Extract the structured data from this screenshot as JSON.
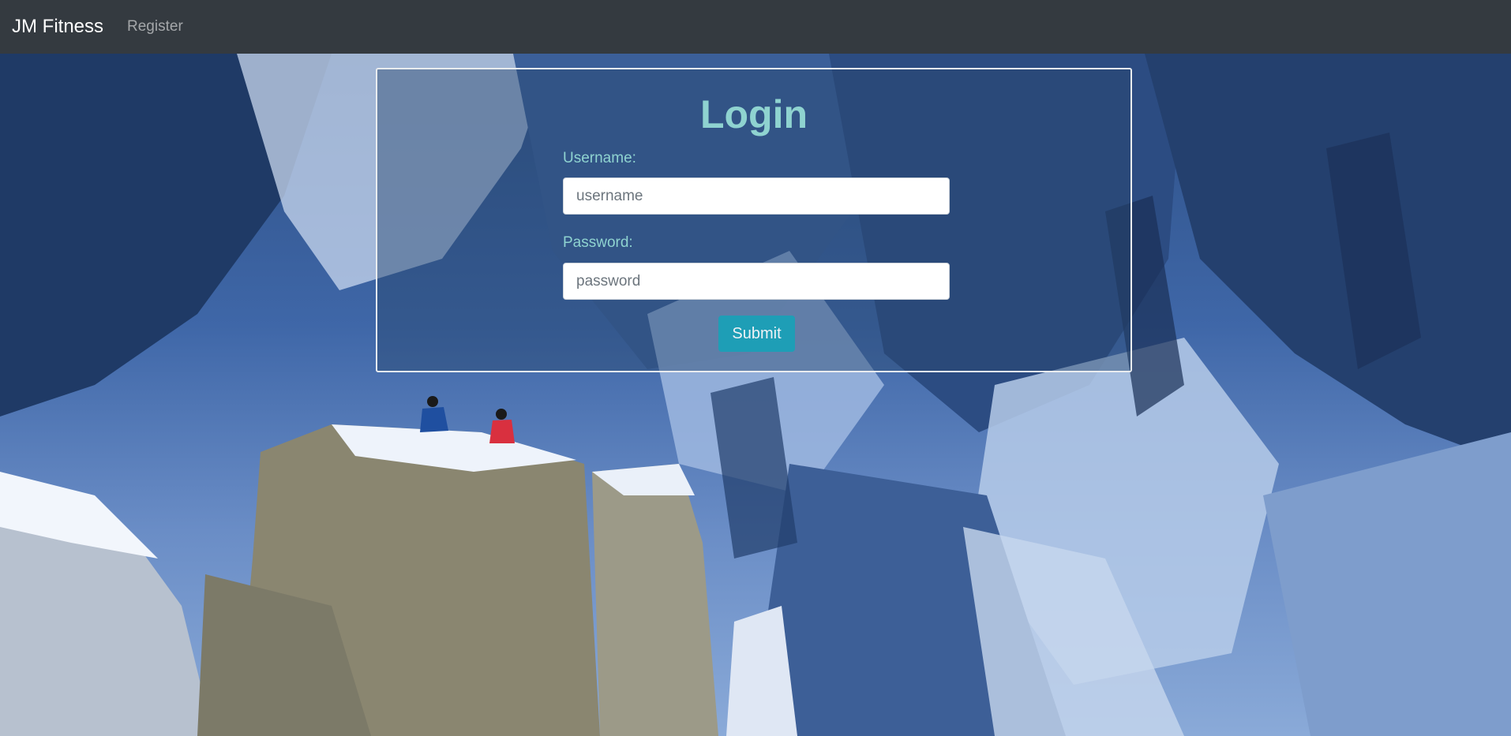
{
  "navbar": {
    "brand": "JM Fitness",
    "register_link": "Register"
  },
  "login": {
    "title": "Login",
    "username_label": "Username:",
    "username_placeholder": "username",
    "username_value": "",
    "password_label": "Password:",
    "password_placeholder": "password",
    "password_value": "",
    "submit_label": "Submit"
  },
  "colors": {
    "navbar_bg": "#343a40",
    "accent_teal": "#8fd3d0",
    "button_bg": "#17a2b8"
  }
}
